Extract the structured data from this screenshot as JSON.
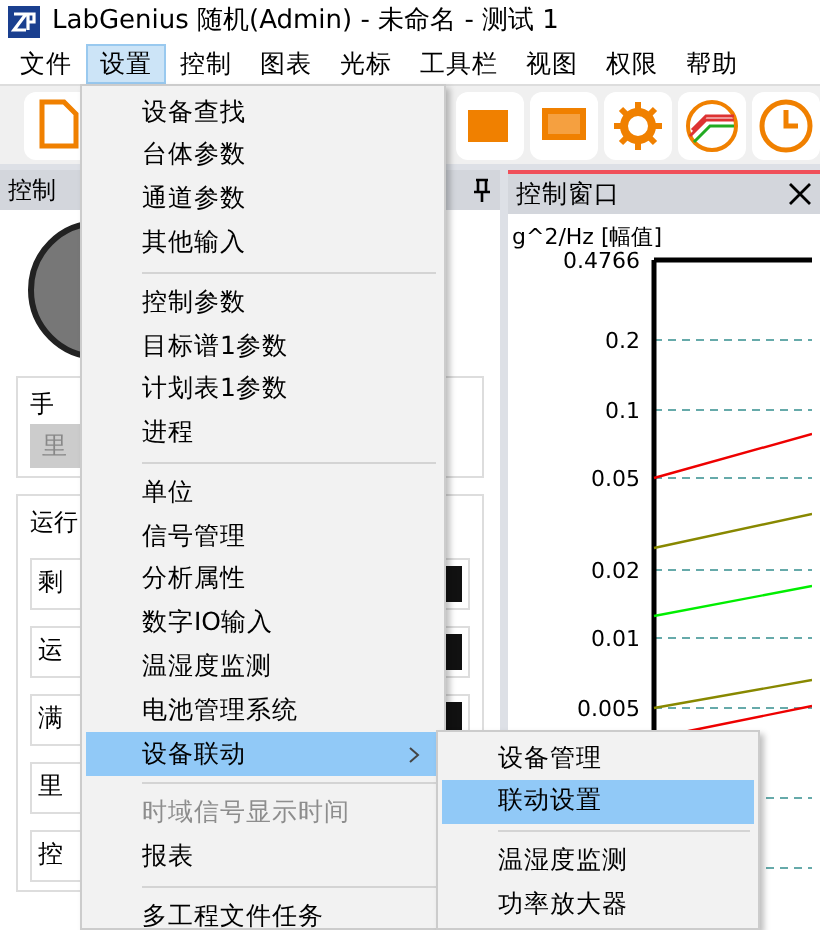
{
  "window": {
    "title": "LabGenius 随机(Admin) - 未命名 - 测试 1"
  },
  "menu_bar": [
    {
      "label": "文件",
      "selected": false
    },
    {
      "label": "设置",
      "selected": true
    },
    {
      "label": "控制",
      "selected": false
    },
    {
      "label": "图表",
      "selected": false
    },
    {
      "label": "光标",
      "selected": false
    },
    {
      "label": "工具栏",
      "selected": false
    },
    {
      "label": "视图",
      "selected": false
    },
    {
      "label": "权限",
      "selected": false
    },
    {
      "label": "帮助",
      "selected": false
    }
  ],
  "left_panel": {
    "title": "控制",
    "manual_group": {
      "label": "手",
      "button": "里"
    },
    "run_group": {
      "label": "运行",
      "rows": [
        "剩",
        "运",
        "满",
        "里",
        "控"
      ]
    }
  },
  "control_window": {
    "title": "控制窗口",
    "y_axis_label": "g^2/Hz [幅值]",
    "y_tick_labels": [
      "0.4766",
      "0.2",
      "0.1",
      "0.05",
      "0.02",
      "0.01",
      "0.005"
    ]
  },
  "dropdown_menu": [
    {
      "kind": "item",
      "label": "设备查找",
      "disabled": false,
      "selected": false
    },
    {
      "kind": "item",
      "label": "台体参数",
      "disabled": false,
      "selected": false
    },
    {
      "kind": "item",
      "label": "通道参数",
      "disabled": false,
      "selected": false
    },
    {
      "kind": "item",
      "label": "其他输入",
      "disabled": false,
      "selected": false
    },
    {
      "kind": "separator"
    },
    {
      "kind": "item",
      "label": "控制参数",
      "disabled": false,
      "selected": false
    },
    {
      "kind": "item",
      "label": "目标谱1参数",
      "disabled": false,
      "selected": false
    },
    {
      "kind": "item",
      "label": "计划表1参数",
      "disabled": false,
      "selected": false
    },
    {
      "kind": "item",
      "label": "进程",
      "disabled": false,
      "selected": false
    },
    {
      "kind": "separator"
    },
    {
      "kind": "item",
      "label": "单位",
      "disabled": false,
      "selected": false
    },
    {
      "kind": "item",
      "label": "信号管理",
      "disabled": false,
      "selected": false
    },
    {
      "kind": "item",
      "label": "分析属性",
      "disabled": false,
      "selected": false
    },
    {
      "kind": "item",
      "label": "数字IO输入",
      "disabled": false,
      "selected": false
    },
    {
      "kind": "item",
      "label": "温湿度监测",
      "disabled": false,
      "selected": false
    },
    {
      "kind": "item",
      "label": "电池管理系统",
      "disabled": false,
      "selected": false
    },
    {
      "kind": "submenu",
      "label": "设备联动",
      "disabled": false,
      "selected": true
    },
    {
      "kind": "separator"
    },
    {
      "kind": "item",
      "label": "时域信号显示时间",
      "disabled": true,
      "selected": false
    },
    {
      "kind": "item",
      "label": "报表",
      "disabled": false,
      "selected": false
    },
    {
      "kind": "separator"
    },
    {
      "kind": "item",
      "label": "多工程文件任务",
      "disabled": false,
      "selected": false
    }
  ],
  "submenu": [
    {
      "kind": "item",
      "label": "设备管理",
      "selected": false
    },
    {
      "kind": "item",
      "label": "联动设置",
      "selected": true
    },
    {
      "kind": "separator"
    },
    {
      "kind": "item",
      "label": "温湿度监测",
      "selected": false
    },
    {
      "kind": "item",
      "label": "功率放大器",
      "selected": false
    }
  ]
}
